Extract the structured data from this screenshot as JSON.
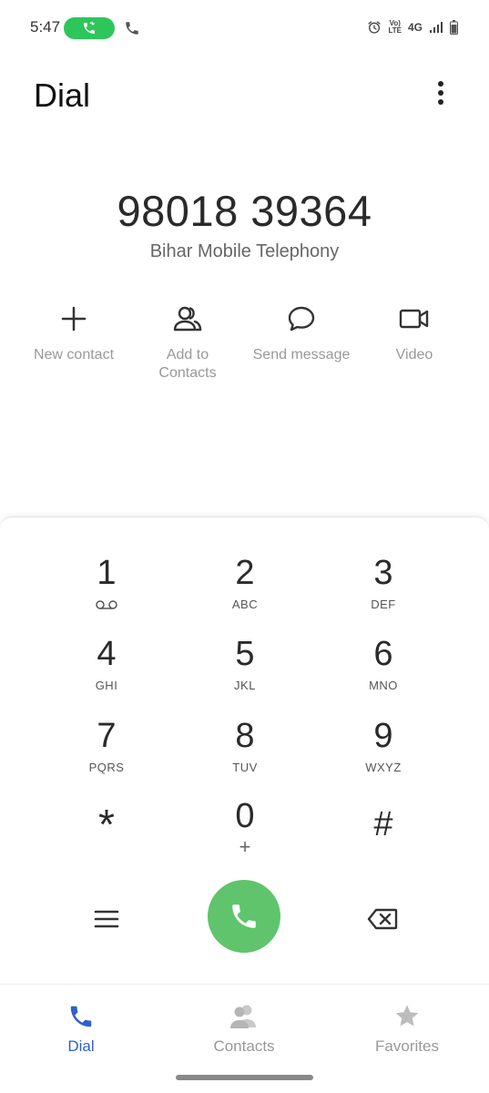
{
  "status_bar": {
    "time": "5:47",
    "volte_top": "Vo)",
    "volte_bottom": "LTE",
    "network": "4G",
    "icons": [
      "call-active-icon",
      "phone-icon",
      "alarm-icon",
      "signal-icon",
      "battery-icon"
    ],
    "call_pill_color": "#2ec65a"
  },
  "header": {
    "title": "Dial"
  },
  "dialer": {
    "number": "98018 39364",
    "carrier": "Bihar Mobile Telephony"
  },
  "actions": [
    {
      "label": "New contact",
      "icon": "plus-icon"
    },
    {
      "label": "Add to\nContacts",
      "icon": "contacts-icon"
    },
    {
      "label": "Send message",
      "icon": "message-icon"
    },
    {
      "label": "Video",
      "icon": "video-icon"
    }
  ],
  "keypad": {
    "keys": [
      {
        "digit": "1",
        "letters": ""
      },
      {
        "digit": "2",
        "letters": "ABC"
      },
      {
        "digit": "3",
        "letters": "DEF"
      },
      {
        "digit": "4",
        "letters": "GHI"
      },
      {
        "digit": "5",
        "letters": "JKL"
      },
      {
        "digit": "6",
        "letters": "MNO"
      },
      {
        "digit": "7",
        "letters": "PQRS"
      },
      {
        "digit": "8",
        "letters": "TUV"
      },
      {
        "digit": "9",
        "letters": "WXYZ"
      },
      {
        "digit": "*",
        "letters": ""
      },
      {
        "digit": "0",
        "letters": "+"
      },
      {
        "digit": "#",
        "letters": ""
      }
    ],
    "call_color": "#5fc46b"
  },
  "nav": {
    "dial": "Dial",
    "contacts": "Contacts",
    "favorites": "Favorites",
    "active_color": "#2f5fd0"
  }
}
